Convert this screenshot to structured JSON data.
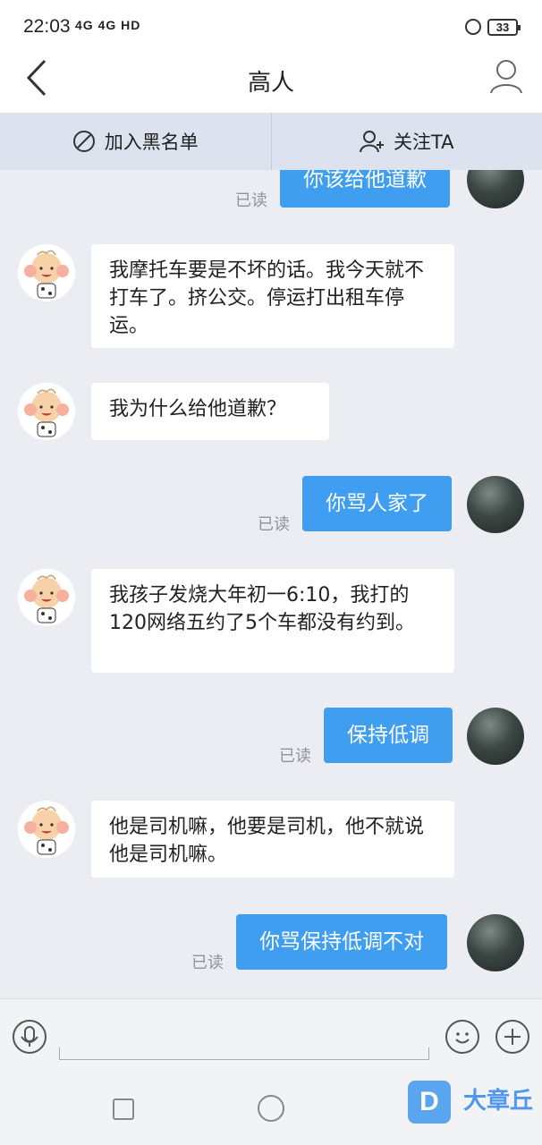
{
  "status_bar": {
    "time": "22:03",
    "network": "4G 4G HD",
    "battery": "33"
  },
  "header": {
    "title": "高人"
  },
  "actions": {
    "block_label": "加入黑名单",
    "follow_label": "关注TA"
  },
  "messages": [
    {
      "from": "me",
      "text": "你该给他道歉",
      "status": "已读"
    },
    {
      "from": "other",
      "text": "我摩托车要是不坏的话。我今天就不打车了。挤公交。停运打出租车停运。"
    },
    {
      "from": "other",
      "text": "我为什么给他道歉？"
    },
    {
      "from": "me",
      "text": "你骂人家了",
      "status": "已读"
    },
    {
      "from": "other",
      "text": "我孩子发烧大年初一6:10，我打的120网络五约了5个车都没有约到。"
    },
    {
      "from": "me",
      "text": "保持低调",
      "status": "已读"
    },
    {
      "from": "other",
      "text": "他是司机嘛，他要是司机，他不就说他是司机嘛。"
    },
    {
      "from": "me",
      "text": "你骂保持低调不对",
      "status": "已读"
    }
  ],
  "watermark": {
    "icon": "D",
    "text": "大章丘"
  },
  "colors": {
    "accent": "#3f9ef0",
    "background": "#ebedf3",
    "action_bar": "#dde3ee"
  }
}
